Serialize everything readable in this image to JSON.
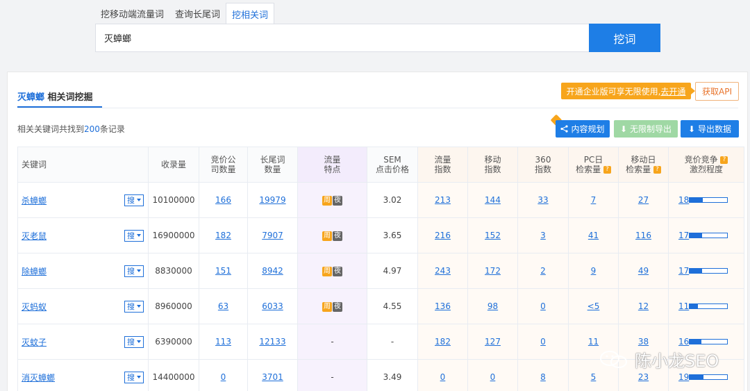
{
  "tabs": [
    "挖移动端流量词",
    "查询长尾词",
    "挖相关词"
  ],
  "search": {
    "value": "灭蟑螂",
    "button": "挖词"
  },
  "panel": {
    "title_keyword": "灭蟑螂",
    "title_suffix": "相关词挖掘",
    "promo_text": "开通企业版可享无限使用,",
    "promo_link": "去开通",
    "api_button": "获取API",
    "count_prefix": "相关关键词共找到",
    "count_num": "200",
    "count_suffix": "条记录",
    "btn_plan": "内容规划",
    "btn_export_free": "无限制导出",
    "btn_export": "导出数据"
  },
  "table": {
    "headers": {
      "keyword": "关键词",
      "index_count": "收录量",
      "bid_companies": [
        "竞价公",
        "司数量"
      ],
      "longtail": [
        "长尾词",
        "数量"
      ],
      "traffic": [
        "流量",
        "特点"
      ],
      "sem": [
        "SEM",
        "点击价格"
      ],
      "flow_index": [
        "流量",
        "指数"
      ],
      "mobile_index": [
        "移动",
        "指数"
      ],
      "s360_index": [
        "360",
        "指数"
      ],
      "pc_daily": [
        "PC日",
        "检索量"
      ],
      "mobile_daily": [
        "移动日",
        "检索量"
      ],
      "competition": [
        "竞价竞争",
        "激烈程度"
      ],
      "q_mark": "?",
      "sou": "搜",
      "zhou": "周",
      "ye": "夜"
    },
    "rows": [
      {
        "keyword": "杀蟑螂",
        "index": "10100000",
        "bid": "166",
        "longtail": "19979",
        "traffic": true,
        "sem": "3.02",
        "flow": "213",
        "mobile": "144",
        "s360": "33",
        "pc": "7",
        "mday": "27",
        "comp": "18",
        "comp_level": 0.35
      },
      {
        "keyword": "灭老鼠",
        "index": "16900000",
        "bid": "182",
        "longtail": "7907",
        "traffic": true,
        "sem": "3.65",
        "flow": "216",
        "mobile": "152",
        "s360": "3",
        "pc": "41",
        "mday": "116",
        "comp": "17",
        "comp_level": 0.33
      },
      {
        "keyword": "除蟑螂",
        "index": "8830000",
        "bid": "151",
        "longtail": "8942",
        "traffic": true,
        "sem": "4.97",
        "flow": "243",
        "mobile": "172",
        "s360": "2",
        "pc": "9",
        "mday": "49",
        "comp": "17",
        "comp_level": 0.33
      },
      {
        "keyword": "灭蚂蚁",
        "index": "8960000",
        "bid": "63",
        "longtail": "6033",
        "traffic": true,
        "sem": "4.55",
        "flow": "136",
        "mobile": "98",
        "s360": "0",
        "pc": "<5",
        "mday": "12",
        "comp": "11",
        "comp_level": 0.22
      },
      {
        "keyword": "灭蚊子",
        "index": "6390000",
        "bid": "113",
        "longtail": "12133",
        "traffic": false,
        "sem": "-",
        "flow": "182",
        "mobile": "127",
        "s360": "0",
        "pc": "11",
        "mday": "38",
        "comp": "16",
        "comp_level": 0.31
      },
      {
        "keyword": "消灭蟑螂",
        "index": "14400000",
        "bid": "0",
        "longtail": "3701",
        "traffic": false,
        "sem": "3.49",
        "flow": "0",
        "mobile": "0",
        "s360": "8",
        "pc": "5",
        "mday": "23",
        "comp": "19",
        "comp_level": 0.37
      }
    ],
    "dash": "-"
  },
  "watermark": "陈小龙SEO"
}
